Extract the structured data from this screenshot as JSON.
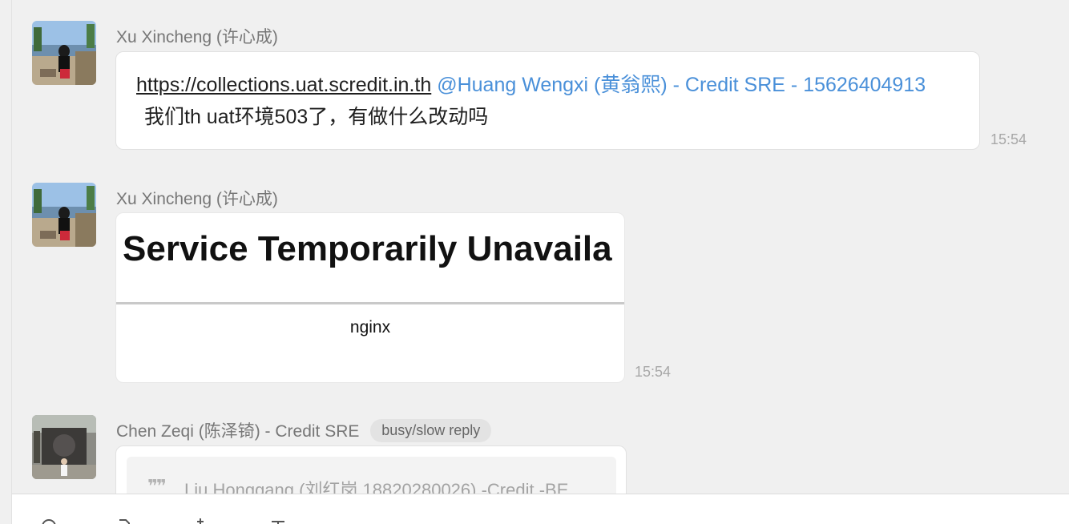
{
  "messages": [
    {
      "sender": "Xu Xincheng (许心成)",
      "link": "https://collections.uat.scredit.in.th",
      "mention": "@Huang Wengxi (黄翁熙) - Credit SRE -",
      "phone": "15626404913",
      "text": "我们th uat环境503了，有做什么改动吗",
      "time": "15:54"
    },
    {
      "sender": "Xu Xincheng (许心成)",
      "image": {
        "title": "Service Temporarily Unavaila",
        "footer": "nginx"
      },
      "time": "15:54"
    },
    {
      "sender": "Chen Zeqi (陈泽锜) - Credit SRE",
      "badge": "busy/slow reply",
      "quote_text": "Liu Honggang (刘红岗 18820280026) -Credit -BE"
    }
  ],
  "icons": {
    "quote": "quote-icon",
    "emoji": "emoji-icon",
    "file": "file-icon",
    "scissors": "scissors-icon",
    "chat": "chat-history-icon"
  },
  "colors": {
    "mention": "#4a90d9",
    "background": "#f0f0f0",
    "bubble": "#ffffff",
    "time": "#a8a8a8"
  }
}
